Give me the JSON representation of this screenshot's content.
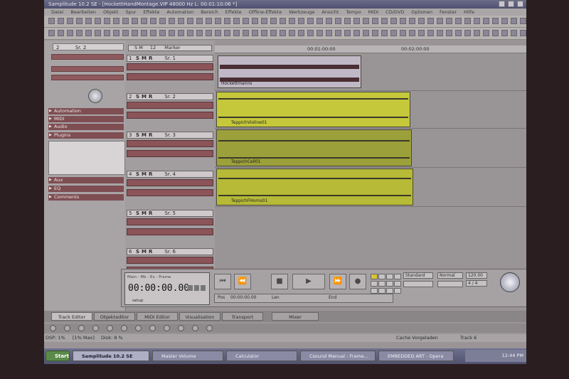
{
  "window": {
    "title": "Samplitude 10.2 SE - [HockettHandMontage.VIP 48000 Hz L: 00:01:10:06 *]",
    "menu": [
      "Datei",
      "Bearbeiten",
      "Objekt",
      "Spur",
      "Effekte",
      "Automation",
      "Bereich",
      "Effekte",
      "Offline-Effekte",
      "Werkzeuge",
      "Ansicht",
      "Tempo",
      "MIDI",
      "CD/DVD",
      "Optionen",
      "Fenster",
      "Hilfe"
    ]
  },
  "left_panel": {
    "track_number": "2",
    "track_name": "Sr. 2",
    "sections": [
      "Automation",
      "MIDI",
      "Audio",
      "Plugins",
      "Aux",
      "EQ",
      "Comments"
    ]
  },
  "tracks": [
    {
      "num": "1",
      "name": "Sr. 1"
    },
    {
      "num": "2",
      "name": "Sr. 2"
    },
    {
      "num": "3",
      "name": "Sr. 3"
    },
    {
      "num": "4",
      "name": "Sr. 4"
    },
    {
      "num": "5",
      "name": "Sr. 5"
    },
    {
      "num": "6",
      "name": "Sr. 6"
    }
  ],
  "track_list_header": {
    "smr": "S M",
    "count": "12",
    "marker": "Marker"
  },
  "ruler": [
    "00:01:00:00",
    "00:02:00:00"
  ],
  "clips": [
    {
      "name": "Hockettmanns"
    },
    {
      "name": "TeppichVioline01"
    },
    {
      "name": "TeppichCell01"
    },
    {
      "name": "TeppichFHorns01"
    }
  ],
  "transport": {
    "mode_label": "Main - Mk - Ex - Frame",
    "timecode": "00:00:00.00",
    "setup_label": "setup",
    "standard": "Standard",
    "normal": "Normal",
    "tempo": "120.00",
    "meter": "4 / 4",
    "pos_label": "Pos",
    "len_label": "Len",
    "end_label": "End",
    "pos_value": "00:00:00.00"
  },
  "tabs": [
    "Track Editor",
    "Objekteditor",
    "MIDI Editor",
    "Visualisation",
    "Transport",
    "Mixer"
  ],
  "status": {
    "dsp": "DSP: 1%",
    "max": "[1% Max]",
    "disk": "Disk: 8 %",
    "cache": "Cache Vorgeladen",
    "track": "Track 6"
  },
  "taskbar": {
    "start": "Start",
    "items": [
      "Samplitude 10.2 SE",
      "Master Volume",
      "Calculator",
      "Csound Manual - Frame...",
      "EMBEDDED ART - Opera"
    ],
    "clock": "12:44 PM"
  },
  "colors": {
    "clip_yellow": "#c4c83a",
    "fx_red": "#8a5458",
    "taskbar": "#5a5c7a"
  }
}
